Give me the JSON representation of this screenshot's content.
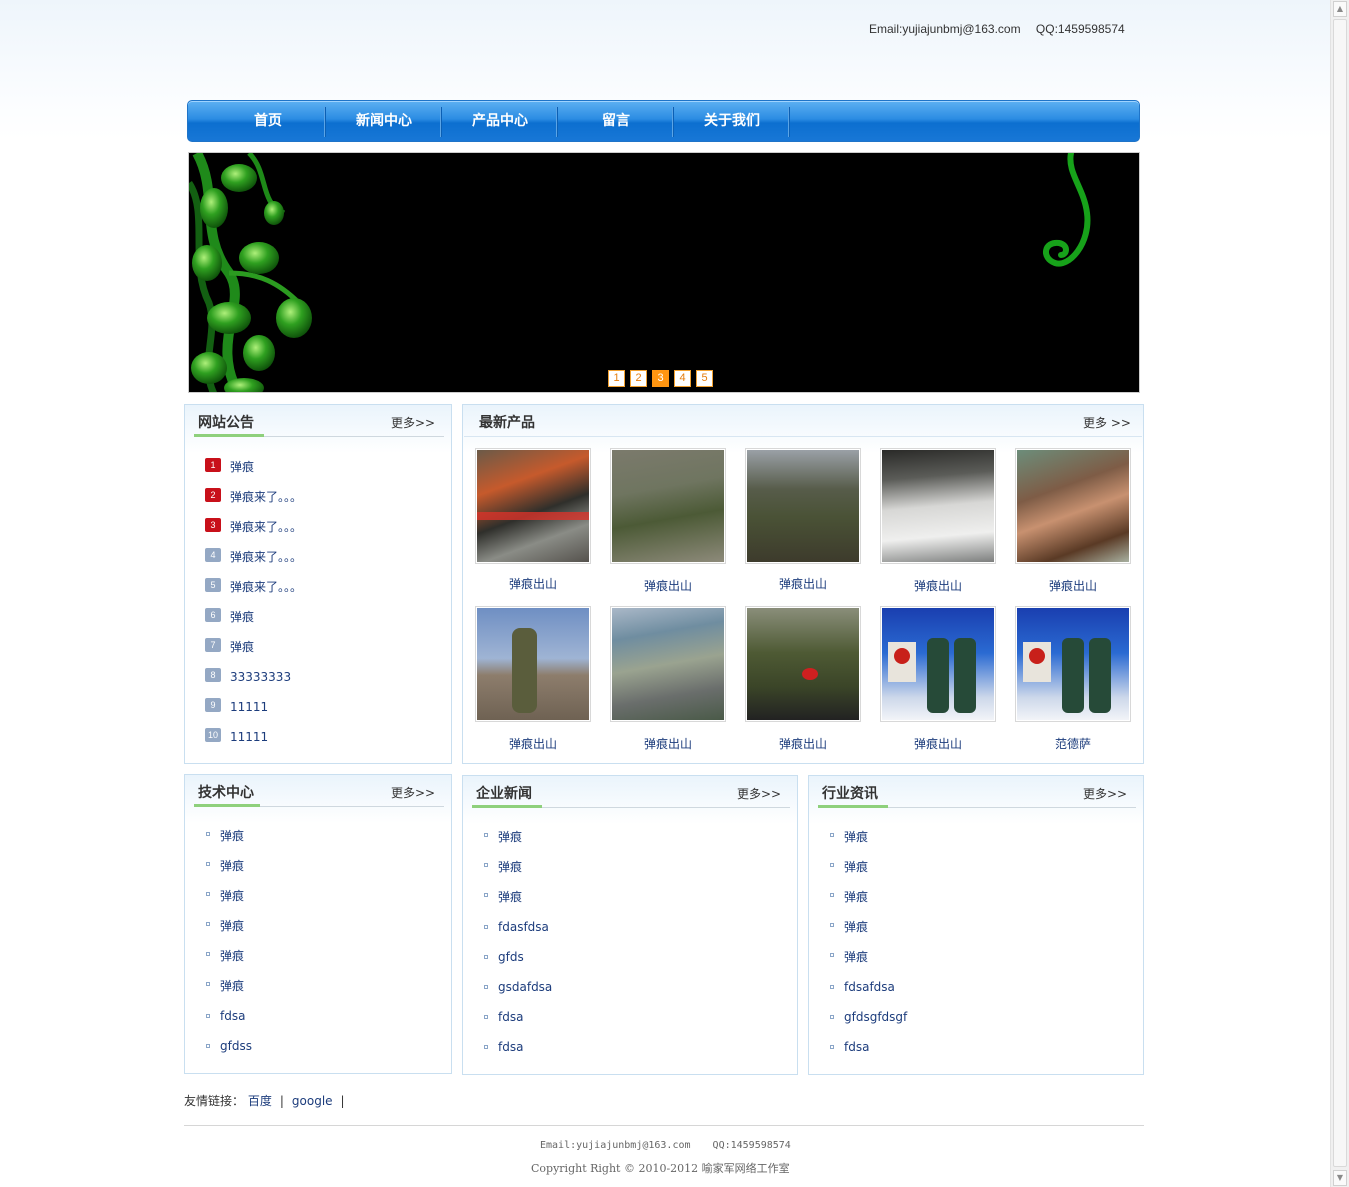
{
  "header": {
    "email": "Email:yujiajunbmj@163.com",
    "qq": "QQ:1459598574"
  },
  "nav": {
    "items": [
      "首页",
      "新闻中心",
      "产品中心",
      "留言",
      "关于我们"
    ]
  },
  "banner": {
    "slides": [
      "1",
      "2",
      "3",
      "4",
      "5"
    ],
    "active_slide": 3
  },
  "announcements": {
    "title": "网站公告",
    "more": "更多>>",
    "items": [
      {
        "num": "1",
        "text": "弹痕"
      },
      {
        "num": "2",
        "text": "弹痕来了。。。"
      },
      {
        "num": "3",
        "text": "弹痕来了。。。"
      },
      {
        "num": "4",
        "text": "弹痕来了。。。"
      },
      {
        "num": "5",
        "text": "弹痕来了。。。"
      },
      {
        "num": "6",
        "text": "弹痕"
      },
      {
        "num": "7",
        "text": "弹痕"
      },
      {
        "num": "8",
        "text": "33333333"
      },
      {
        "num": "9",
        "text": "11111"
      },
      {
        "num": "10",
        "text": "11111"
      }
    ]
  },
  "products": {
    "title": "最新产品",
    "more": "更多 >>",
    "items": [
      {
        "caption": "弹痕出山"
      },
      {
        "caption": "弹痕出山"
      },
      {
        "caption": "弹痕出山"
      },
      {
        "caption": "弹痕出山"
      },
      {
        "caption": "弹痕出山"
      },
      {
        "caption": "弹痕出山"
      },
      {
        "caption": "弹痕出山"
      },
      {
        "caption": "弹痕出山"
      },
      {
        "caption": "弹痕出山"
      },
      {
        "caption": "范德萨"
      }
    ]
  },
  "tech_center": {
    "title": "技术中心",
    "more": "更多>>",
    "items": [
      "弹痕",
      "弹痕",
      "弹痕",
      "弹痕",
      "弹痕",
      "弹痕",
      "fdsa",
      "gfdss"
    ]
  },
  "company_news": {
    "title": "企业新闻",
    "more": "更多>>",
    "items": [
      "弹痕",
      "弹痕",
      "弹痕",
      "fdasfdsa",
      "gfds",
      "gsdafdsa",
      "fdsa",
      "fdsa"
    ]
  },
  "industry_news": {
    "title": "行业资讯",
    "more": "更多>>",
    "items": [
      "弹痕",
      "弹痕",
      "弹痕",
      "弹痕",
      "弹痕",
      "fdsafdsa",
      "gfdsgfdsgf",
      "fdsa"
    ]
  },
  "friend_links": {
    "label": "友情链接：",
    "links": [
      "百度",
      "google"
    ]
  },
  "footer": {
    "email": "Email:yujiajunbmj@163.com",
    "qq": "QQ:1459598574",
    "copyright": "Copyright Right © 2010-2012 喻家军网络工作室"
  }
}
